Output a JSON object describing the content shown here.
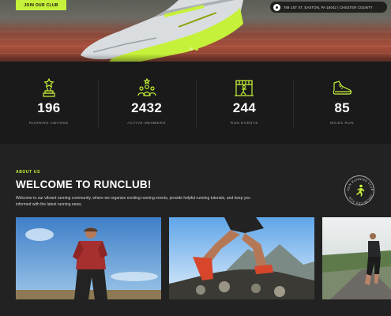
{
  "hero": {
    "join_button": "JOIN OUR CLUB",
    "address": "769 1ST ST, EASTON, PA 18042 | CHESTER COUNTY",
    "slide_count": 2,
    "active_slide": 2
  },
  "stats": [
    {
      "icon": "trophy-icon",
      "value": "196",
      "label": "RUNNING AWARDS"
    },
    {
      "icon": "team-icon",
      "value": "2432",
      "label": "ACTIVE MEMBERS"
    },
    {
      "icon": "finish-line-icon",
      "value": "244",
      "label": "RUN EVENTS"
    },
    {
      "icon": "shoe-icon",
      "value": "85",
      "label": "MILES RUN"
    }
  ],
  "about": {
    "tag": "ABOUT US",
    "title": "WELCOME TO RUNCLUB!",
    "text": "Welcome to our vibrant running community, where we organize exciting running events, provide helpful running tutorials, and keep you informed with the latest running news.",
    "badge_text": "JOIN RUNNING CLUB · UNLIMITED FUN"
  },
  "colors": {
    "accent": "#c6f13a",
    "background": "#1e1e1e",
    "stats_bg": "#1a1a1a",
    "about_bg": "#222222"
  }
}
